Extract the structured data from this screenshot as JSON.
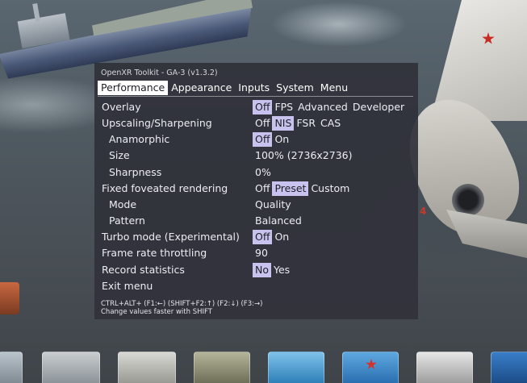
{
  "window_title": "OpenXR Toolkit - GA-3 (v1.3.2)",
  "tabs": [
    {
      "label": "Performance",
      "active": true
    },
    {
      "label": "Appearance",
      "active": false
    },
    {
      "label": "Inputs",
      "active": false
    },
    {
      "label": "System",
      "active": false
    },
    {
      "label": "Menu",
      "active": false
    }
  ],
  "settings": [
    {
      "label": "Overlay",
      "indent": false,
      "options": [
        "Off",
        "FPS",
        "Advanced",
        "Developer"
      ],
      "selected": 0
    },
    {
      "label": "Upscaling/Sharpening",
      "indent": false,
      "options": [
        "Off",
        "NIS",
        "FSR",
        "CAS"
      ],
      "selected": 1
    },
    {
      "label": "Anamorphic",
      "indent": true,
      "options": [
        "Off",
        "On"
      ],
      "selected": 0
    },
    {
      "label": "Size",
      "indent": true,
      "options": [
        "100% (2736x2736)"
      ],
      "selected": -1
    },
    {
      "label": "Sharpness",
      "indent": true,
      "options": [
        "0%"
      ],
      "selected": -1
    },
    {
      "label": "Fixed foveated rendering",
      "indent": false,
      "options": [
        "Off",
        "Preset",
        "Custom"
      ],
      "selected": 1
    },
    {
      "label": "Mode",
      "indent": true,
      "options": [
        "Quality"
      ],
      "selected": -1
    },
    {
      "label": "Pattern",
      "indent": true,
      "options": [
        "Balanced"
      ],
      "selected": -1
    },
    {
      "label": "Turbo mode (Experimental)",
      "indent": false,
      "options": [
        "Off",
        "On"
      ],
      "selected": 0
    },
    {
      "label": "Frame rate throttling",
      "indent": false,
      "options": [
        "90"
      ],
      "selected": -1
    },
    {
      "label": "Record statistics",
      "indent": false,
      "options": [
        "No",
        "Yes"
      ],
      "selected": 0
    },
    {
      "label": "Exit menu",
      "indent": false,
      "options": [],
      "selected": -1
    }
  ],
  "footer": {
    "line1": "CTRL+ALT+ (F1:←) (SHIFT+F2:↑) (F2:↓) (F3:→)",
    "line2": "Change values faster with SHIFT"
  },
  "colors": {
    "panel_bg": "#30323a",
    "selected_option_bg": "#c8c3ee",
    "active_tab_bg": "#ffffff",
    "jet_marking_red": "#c62a22"
  }
}
